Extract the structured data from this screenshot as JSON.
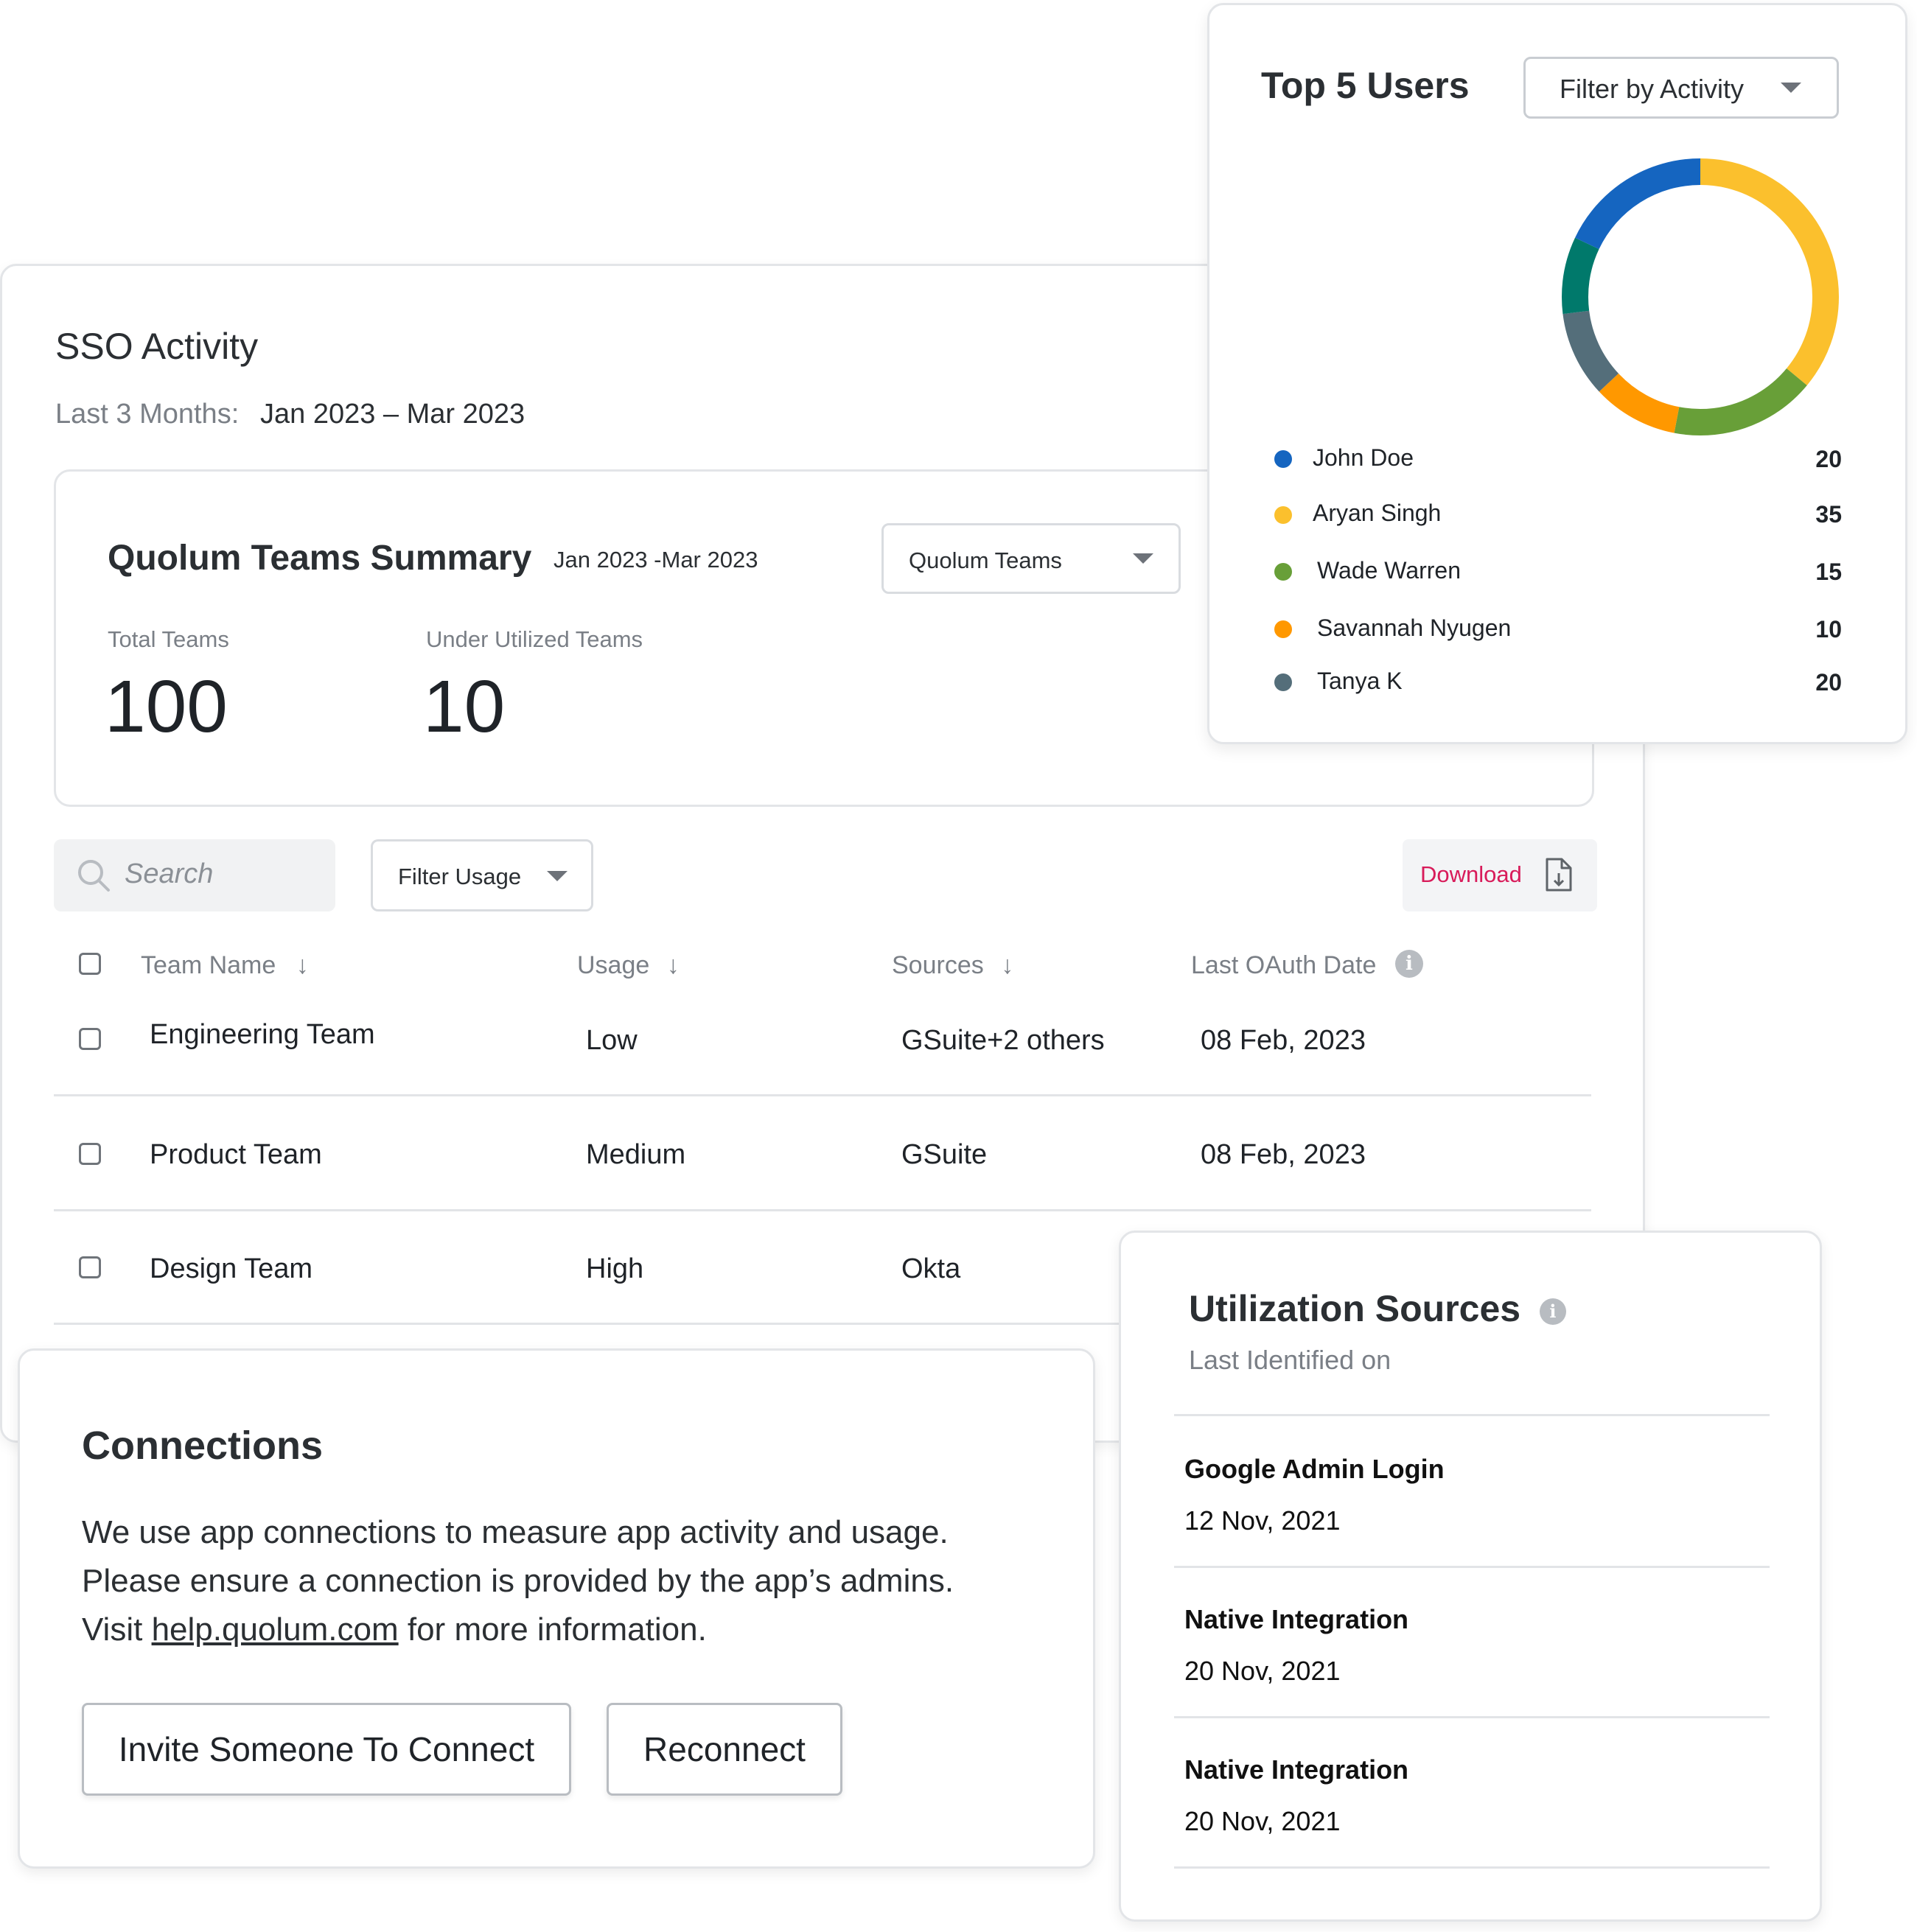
{
  "sso": {
    "title": "SSO Activity",
    "period_label": "Last 3 Months:",
    "period_value": "Jan 2023 – Mar 2023"
  },
  "summary": {
    "title": "Quolum Teams Summary",
    "date_range": "Jan 2023 -Mar 2023",
    "dropdown_value": "Quolum Teams",
    "total_label": "Total Teams",
    "total_value": "100",
    "under_label": "Under Utilized Teams",
    "under_value": "10"
  },
  "toolbar": {
    "search_placeholder": "Search",
    "filter_label": "Filter Usage",
    "download_label": "Download"
  },
  "table": {
    "headers": [
      "Team Name",
      "Usage",
      "Sources",
      "Last OAuth Date"
    ],
    "rows": [
      {
        "team": "Engineering Team",
        "usage": "Low",
        "sources": "GSuite+2 others",
        "date": "08 Feb, 2023"
      },
      {
        "team": "Product Team",
        "usage": "Medium",
        "sources": "GSuite",
        "date": "08 Feb, 2023"
      },
      {
        "team": "Design Team",
        "usage": "High",
        "sources": "Okta",
        "date": ""
      }
    ]
  },
  "top_users": {
    "title": "Top 5 Users",
    "filter_label": "Filter by Activity",
    "users": [
      {
        "name": "John Doe",
        "value": "20",
        "color": "#1565c0"
      },
      {
        "name": "Aryan Singh",
        "value": "35",
        "color": "#fbc02d"
      },
      {
        "name": "Wade Warren",
        "value": "15",
        "color": "#689f38"
      },
      {
        "name": "Savannah Nyugen",
        "value": "10",
        "color": "#ff9800"
      },
      {
        "name": "Tanya K",
        "value": "20",
        "color": "#546e7a"
      }
    ],
    "teal_color": "#00796b"
  },
  "connections": {
    "title": "Connections",
    "line1": "We use app connections to measure app activity and usage.",
    "line2": "Please ensure a connection is provided by the app’s admins.",
    "line3_pre": "Visit ",
    "link": "help.quolum.com",
    "line3_post": " for more information.",
    "invite_label": "Invite Someone To Connect",
    "reconnect_label": "Reconnect"
  },
  "utilization": {
    "title": "Utilization Sources",
    "subtitle": "Last Identified on",
    "items": [
      {
        "name": "Google Admin Login",
        "date": "12 Nov, 2021"
      },
      {
        "name": "Native Integration",
        "date": "20 Nov, 2021"
      },
      {
        "name": "Native Integration",
        "date": "20 Nov, 2021"
      }
    ]
  },
  "colors": {
    "accent_red": "#d81b5a",
    "border": "#e3e5e8"
  }
}
